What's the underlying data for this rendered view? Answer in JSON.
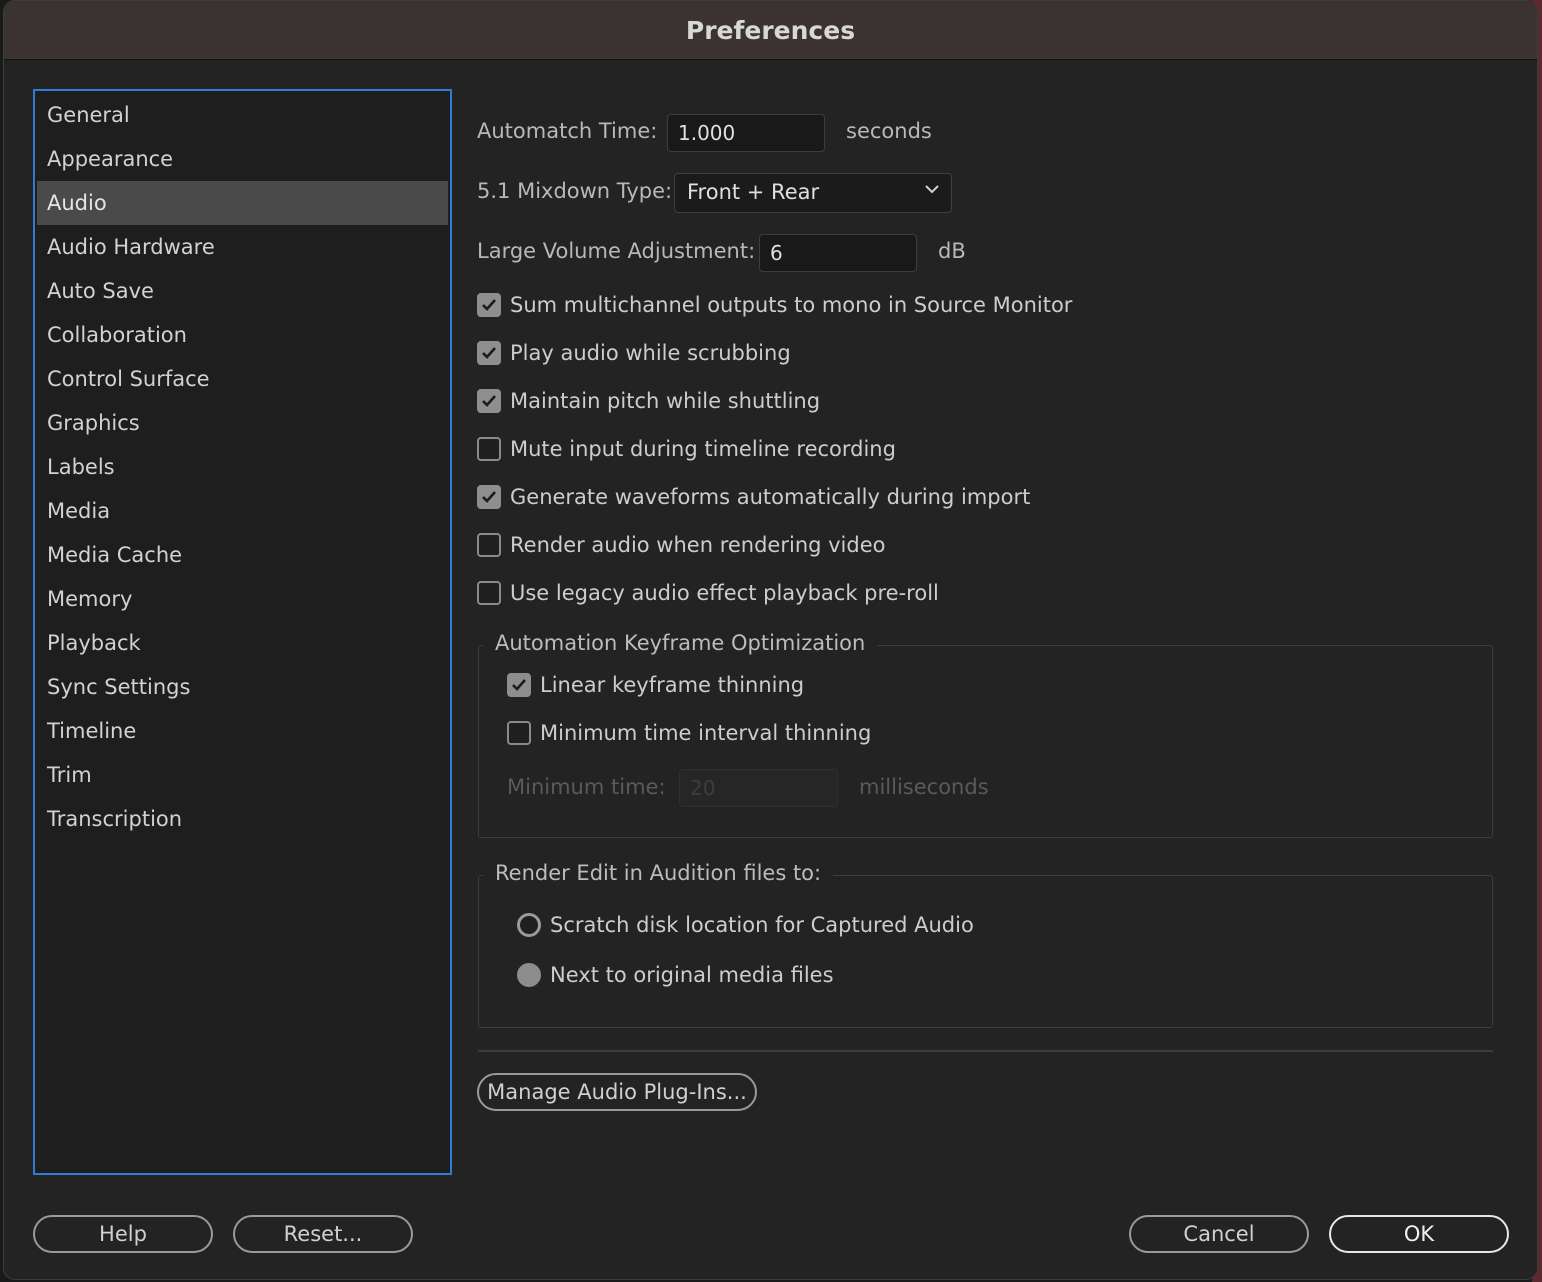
{
  "window": {
    "title": "Preferences"
  },
  "sidebar": {
    "items": [
      {
        "label": "General"
      },
      {
        "label": "Appearance"
      },
      {
        "label": "Audio",
        "selected": true
      },
      {
        "label": "Audio Hardware"
      },
      {
        "label": "Auto Save"
      },
      {
        "label": "Collaboration"
      },
      {
        "label": "Control Surface"
      },
      {
        "label": "Graphics"
      },
      {
        "label": "Labels"
      },
      {
        "label": "Media"
      },
      {
        "label": "Media Cache"
      },
      {
        "label": "Memory"
      },
      {
        "label": "Playback"
      },
      {
        "label": "Sync Settings"
      },
      {
        "label": "Timeline"
      },
      {
        "label": "Trim"
      },
      {
        "label": "Transcription"
      }
    ]
  },
  "audio": {
    "automatch": {
      "label": "Automatch Time:",
      "value": "1.000",
      "unit": "seconds"
    },
    "mixdown": {
      "label": "5.1 Mixdown Type:",
      "value": "Front + Rear"
    },
    "large_volume": {
      "label": "Large Volume Adjustment:",
      "value": "6",
      "unit": "dB"
    },
    "checkboxes": [
      {
        "label": "Sum multichannel outputs to mono in Source Monitor",
        "checked": true
      },
      {
        "label": "Play audio while scrubbing",
        "checked": true
      },
      {
        "label": "Maintain pitch while shuttling",
        "checked": true
      },
      {
        "label": "Mute input during timeline recording",
        "checked": false
      },
      {
        "label": "Generate waveforms automatically during import",
        "checked": true
      },
      {
        "label": "Render audio when rendering video",
        "checked": false
      },
      {
        "label": "Use legacy audio effect playback pre-roll",
        "checked": false
      }
    ],
    "keyframe_group": {
      "title": "Automation Keyframe Optimization",
      "linear": {
        "label": "Linear keyframe thinning",
        "checked": true
      },
      "min_interval": {
        "label": "Minimum time interval thinning",
        "checked": false
      },
      "min_time": {
        "label": "Minimum time:",
        "value": "20",
        "unit": "milliseconds"
      }
    },
    "render_group": {
      "title": "Render Edit in Audition files to:",
      "options": [
        {
          "label": "Scratch disk location for Captured Audio",
          "selected": false
        },
        {
          "label": "Next to original media files",
          "selected": true
        }
      ]
    },
    "manage_plugins_label": "Manage Audio Plug-Ins..."
  },
  "footer": {
    "help": "Help",
    "reset": "Reset...",
    "cancel": "Cancel",
    "ok": "OK"
  },
  "icons": {
    "checkmark": "checkmark-icon",
    "chevron": "chevron-down-icon"
  },
  "colors": {
    "selection_focus": "#2f7bd6",
    "window_bg": "#232323",
    "titlebar_bg": "#3b3232",
    "selected_item_bg": "#4a4a4a"
  }
}
